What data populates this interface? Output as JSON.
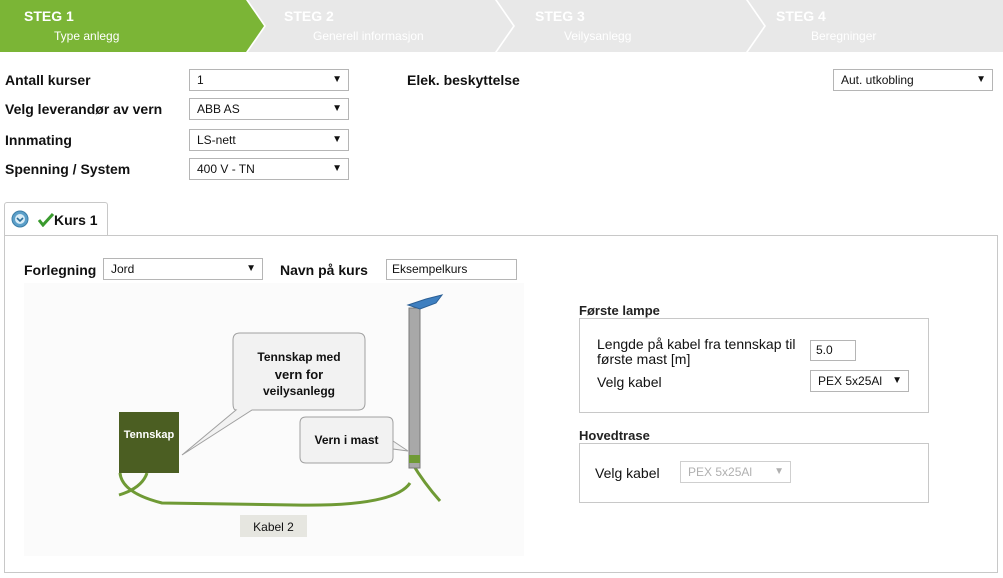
{
  "steps": [
    {
      "title": "STEG 1",
      "subtitle": "Type anlegg"
    },
    {
      "title": "STEG 2",
      "subtitle": "Generell informasjon"
    },
    {
      "title": "STEG 3",
      "subtitle": "Veilysanlegg"
    },
    {
      "title": "STEG 4",
      "subtitle": "Beregninger"
    }
  ],
  "colors": {
    "active_step": "#7bb536",
    "inactive_step": "#e8e8e8",
    "inactive_text": "#ffffff",
    "cabinet": "#4b5e22",
    "cable": "#6f9a35"
  },
  "form": {
    "antall_kurser": {
      "label": "Antall kurser",
      "value": "1"
    },
    "leverandor": {
      "label": "Velg leverandør av vern",
      "value": "ABB AS"
    },
    "innmating": {
      "label": "Innmating",
      "value": "LS-nett"
    },
    "spenning": {
      "label": "Spenning / System",
      "value": "400 V - TN"
    },
    "elek": {
      "label": "Elek. beskyttelse",
      "value": "Aut. utkobling"
    }
  },
  "tab": {
    "label": "Kurs 1",
    "icon": "chevron-down-icon",
    "check_icon": "check-icon"
  },
  "kurs": {
    "forlegning": {
      "label": "Forlegning",
      "value": "Jord"
    },
    "navn": {
      "label": "Navn på kurs",
      "value": "Eksempelkurs"
    }
  },
  "diagram": {
    "bubble1": [
      "Tennskap  med",
      "vern  for",
      "veilysanlegg"
    ],
    "bubble2": "Vern i mast",
    "cabinet": "Tennskap",
    "cable_label": "Kabel 2"
  },
  "forste_lampe": {
    "legend": "Første lampe",
    "lengde_label_line1": "Lengde på kabel fra tennskap til",
    "lengde_label_line2": "første mast [m]",
    "lengde_value": "5.0",
    "kabel_label": "Velg kabel",
    "kabel_value": "PEX 5x25Al"
  },
  "hovedtrase": {
    "legend": "Hovedtrase",
    "kabel_label": "Velg kabel",
    "kabel_value": "PEX 5x25Al"
  }
}
